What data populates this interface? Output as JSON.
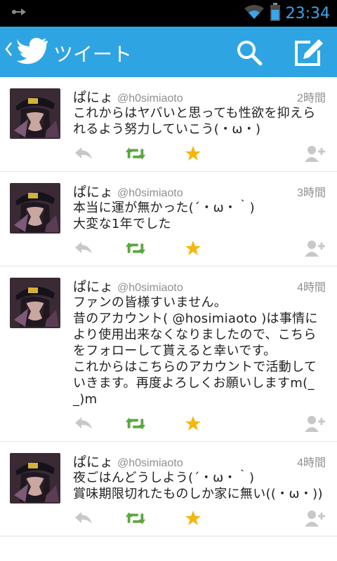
{
  "status_bar": {
    "left_icon": "usb-debug-icon",
    "time": "23:34",
    "wifi_icon": "wifi-icon",
    "battery_icon": "battery-icon",
    "accent_color": "#3aa6e8"
  },
  "app_bar": {
    "title": "ツイート",
    "back_icon": "chevron-left-icon",
    "logo_icon": "twitter-bird-icon",
    "search_icon": "search-icon",
    "compose_icon": "compose-icon",
    "background_color": "#2fa4e2"
  },
  "tweets": [
    {
      "name": "ぱにょ",
      "handle": "@h0simiaoto",
      "time": "2時間",
      "text": "これからはヤバいと思っても性欲を抑えられるよう努力していこう(・ω・)"
    },
    {
      "name": "ぱにょ",
      "handle": "@h0simiaoto",
      "time": "3時間",
      "text": "本当に運が無かった(´・ω・｀)\n大変な1年でした"
    },
    {
      "name": "ぱにょ",
      "handle": "@h0simiaoto",
      "time": "4時間",
      "text": "ファンの皆様すいません。\n昔のアカウント( @hosimiaoto )は事情により使用出来なくなりましたので、こちらをフォローして貰えると幸いです。\nこれからはこちらのアカウントで活動していきます。再度よろしくお願いしますm(_ _)m"
    },
    {
      "name": "ぱにょ",
      "handle": "@h0simiaoto",
      "time": "4時間",
      "text": "夜ごはんどうしよう(´・ω・｀)\n賞味期限切れたものしか家に無い((・ω・))"
    }
  ],
  "action_colors": {
    "reply": "#c8c8c8",
    "retweet": "#5aa83c",
    "favorite": "#f4b70f",
    "follow": "#c8c8c8"
  }
}
